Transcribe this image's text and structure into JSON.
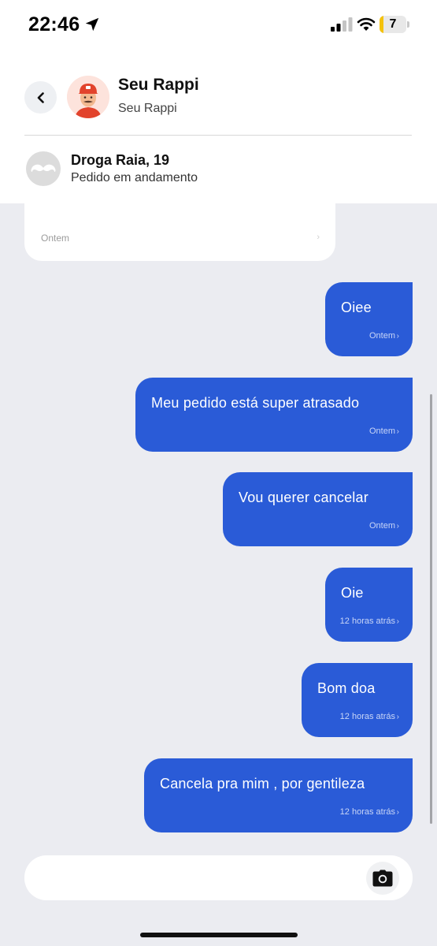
{
  "status_bar": {
    "time": "22:46",
    "battery": "7",
    "icons": [
      "location-arrow-icon",
      "cellular-signal-icon",
      "wifi-icon",
      "battery-icon"
    ]
  },
  "header": {
    "title": "Seu Rappi",
    "subtitle": "Seu Rappi",
    "back_icon": "chevron-left-icon",
    "avatar": "courier-avatar"
  },
  "order": {
    "store": "Droga Raia, 19",
    "status": "Pedido em andamento",
    "store_icon": "mustache-icon"
  },
  "chat": {
    "incoming_time": "Ontem",
    "messages": [
      {
        "text": "Oiee",
        "time": "Ontem"
      },
      {
        "text": "Meu pedido está super atrasado",
        "time": "Ontem"
      },
      {
        "text": "Vou querer cancelar",
        "time": "Ontem"
      },
      {
        "text": "Oie",
        "time": "12 horas atrás"
      },
      {
        "text": "Bom doa",
        "time": "12 horas atrás"
      },
      {
        "text": "Cancela pra mim , por gentileza",
        "time": "12 horas atrás"
      }
    ]
  },
  "composer": {
    "value": "",
    "camera_icon": "camera-icon"
  },
  "colors": {
    "accent": "#2a5bd7",
    "background": "#ebecf1",
    "panel": "#ffffff"
  }
}
